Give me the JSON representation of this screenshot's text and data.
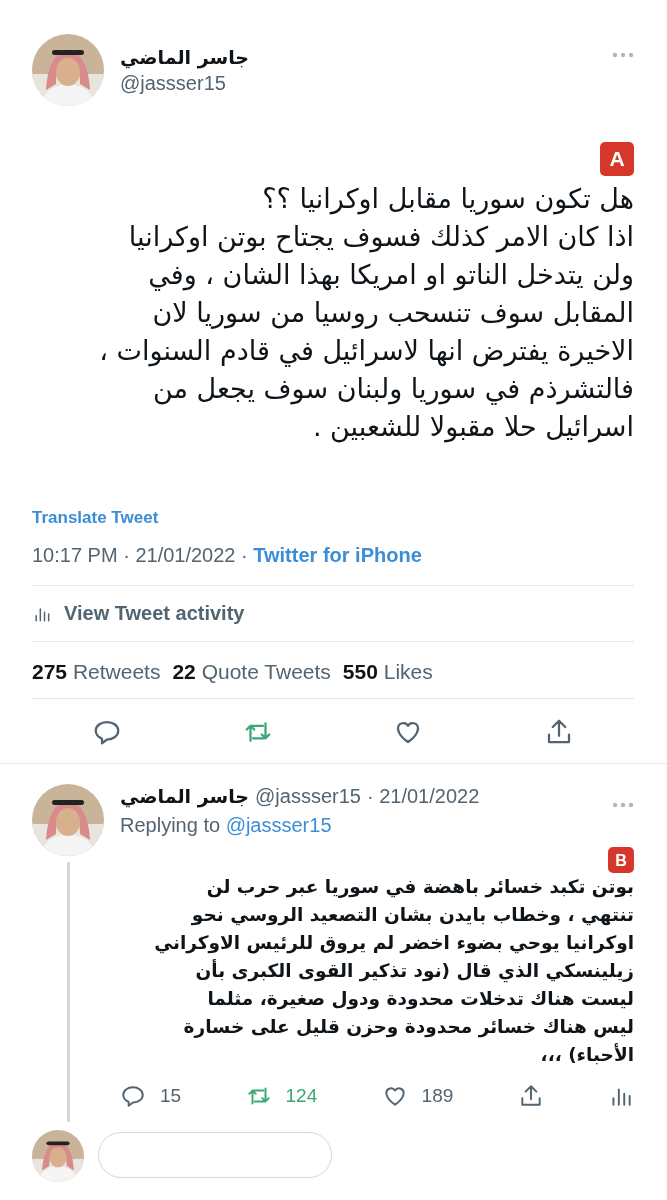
{
  "tweet": {
    "author": {
      "name": "جاسر الماضي",
      "handle": "@jassser15"
    },
    "badge": "A",
    "text": "هل تكون سوريا مقابل اوكرانيا ؟؟\nاذا كان الامر كذلك فسوف يجتاح بوتن اوكرانيا\nولن يتدخل الناتو او امريكا بهذا الشان ، وفي\nالمقابل سوف تنسحب روسيا من سوريا لان\nالاخيرة يفترض انها لاسرائيل في قادم السنوات ،\nفالتشرذم في سوريا ولبنان سوف يجعل من\nاسرائيل حلا مقبولا للشعبين .",
    "translate": "Translate Tweet",
    "timestamp": "10:17 PM · 21/01/2022 · ",
    "source": "Twitter for iPhone",
    "activity": "View Tweet activity",
    "stats": {
      "retweets": {
        "count": "275",
        "label": "Retweets"
      },
      "quote_tweets": {
        "count": "22",
        "label": "Quote Tweets"
      },
      "likes": {
        "count": "550",
        "label": "Likes"
      }
    },
    "retweeted": true,
    "actions": [
      {
        "kind": "reply"
      },
      {
        "kind": "retweet"
      },
      {
        "kind": "like"
      },
      {
        "kind": "share"
      }
    ]
  },
  "reply": {
    "author": {
      "name": "جاسر الماضي",
      "handle": "@jassser15"
    },
    "date": " · 21/01/2022",
    "replying_label": "Replying to ",
    "replying_to": "@jassser15",
    "badge": "B",
    "text": "بوتن تكبد خسائر باهضة في سوريا عبر حرب لن\nتنتهي ، وخطاب بايدن بشان التصعيد الروسي نحو\nاوكرانيا يوحي بضوء اخضر لم يروق للرئيس الاوكراني\nزيلينسكي الذي قال (نود تذكير القوى الكبرى بأن\nليست هناك تدخلات محدودة ودول صغيرة، مثلما\nليس هناك خسائر محدودة وحزن قليل على خسارة\nالأحباء) ،،،",
    "retweeted": true,
    "counts": {
      "replies": "15",
      "retweets": "124",
      "likes": "189"
    }
  }
}
